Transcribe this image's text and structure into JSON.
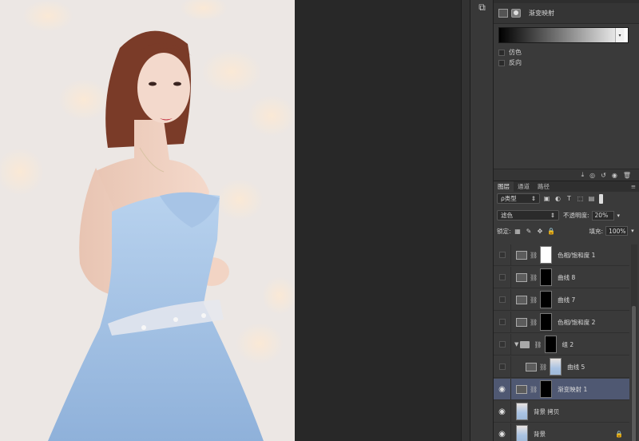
{
  "canvas": {
    "description_icon": "photo-canvas"
  },
  "properties": {
    "tabs": [
      "",
      "",
      ""
    ],
    "title": "渐变映射",
    "checkbox_dither": "仿色",
    "checkbox_reverse": "反向"
  },
  "layers_panel": {
    "tabs": [
      "图层",
      "通道",
      "路径"
    ],
    "filter_kind": "ρ类型",
    "blend_mode": "滤色",
    "opacity_label": "不透明度:",
    "opacity_value": "20%",
    "lock_label": "锁定:",
    "fill_label": "填充:",
    "fill_value": "100%",
    "layers": [
      {
        "name": "色相/饱和度 1",
        "visible": false,
        "thumb": "white"
      },
      {
        "name": "曲线 8",
        "visible": false,
        "thumb": "black"
      },
      {
        "name": "曲线 7",
        "visible": false,
        "thumb": "black"
      },
      {
        "name": "色相/饱和度 2",
        "visible": false,
        "thumb": "black"
      },
      {
        "name": "组 2",
        "visible": false,
        "thumb": "black"
      },
      {
        "name": "曲线 5",
        "visible": false,
        "thumb": "photo"
      },
      {
        "name": "渐变映射 1",
        "visible": true,
        "thumb": "black",
        "selected": true
      },
      {
        "name": "背景 拷贝",
        "visible": true,
        "thumb": "photo"
      },
      {
        "name": "背景",
        "visible": true,
        "thumb": "photo"
      }
    ]
  },
  "colors": {
    "selected_row": "#4f5872",
    "panel_bg": "#3a3a3a"
  }
}
